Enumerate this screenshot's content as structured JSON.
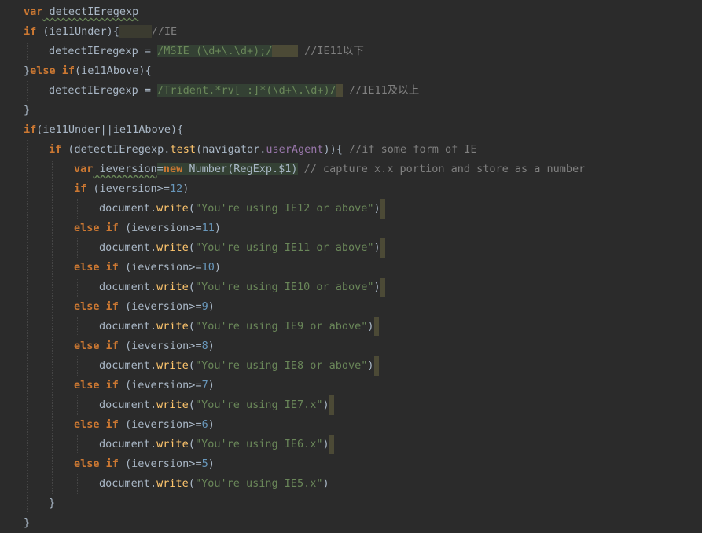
{
  "code": {
    "l1_kw": "var",
    "l1_id": " detectIEregexp",
    "l2_kw": "if",
    "l2_rest": " (ie11Under){",
    "l2_cm": "//IE",
    "l3_a": "detectIEregexp = ",
    "l3_s1": "/MSIE (\\d+\\.\\d+);/",
    "l3_cm": "//IE11以下",
    "l4_a": "}",
    "l4_kw1": "else",
    "l4_kw2": " if",
    "l4_rest": "(ie11Above){",
    "l5_a": "detectIEregexp = ",
    "l5_s1": "/Trident.*rv[ :]*(\\d+\\.\\d+)/",
    "l5_cm": "//IE11及以上",
    "l6": "}",
    "l7_kw": "if",
    "l7_rest": "(ie11Under||ie11Above){",
    "l8_kw": "if",
    "l8_a": " (detectIEregexp.",
    "l8_fn": "test",
    "l8_b": "(navigator.",
    "l8_prop": "userAgent",
    "l8_c": ")){",
    "l8_cm": " //if some form of IE",
    "l9_kw": "var",
    "l9_id": " ieversion",
    "l9_eq": "=",
    "l9_new": "new",
    "l9_rest": " Number(RegExp.$1)",
    "l9_cm": " // capture x.x portion and store as a number",
    "l10_kw": "if",
    "l10_a": " (ieversion>=",
    "l10_n": "12",
    "l10_b": ")",
    "l11_a": "document.",
    "l11_fn": "write",
    "l11_b": "(",
    "l11_s": "\"You're using IE12 or above\"",
    "l11_c": ")",
    "l12_kw": "else if",
    "l12_a": " (ieversion>=",
    "l12_n": "11",
    "l12_b": ")",
    "l13_a": "document.",
    "l13_fn": "write",
    "l13_b": "(",
    "l13_s": "\"You're using IE11 or above\"",
    "l13_c": ")",
    "l14_kw": "else if",
    "l14_a": " (ieversion>=",
    "l14_n": "10",
    "l14_b": ")",
    "l15_a": "document.",
    "l15_fn": "write",
    "l15_b": "(",
    "l15_s": "\"You're using IE10 or above\"",
    "l15_c": ")",
    "l16_kw": "else if",
    "l16_a": " (ieversion>=",
    "l16_n": "9",
    "l16_b": ")",
    "l17_a": "document.",
    "l17_fn": "write",
    "l17_b": "(",
    "l17_s": "\"You're using IE9 or above\"",
    "l17_c": ")",
    "l18_kw": "else if",
    "l18_a": " (ieversion>=",
    "l18_n": "8",
    "l18_b": ")",
    "l19_a": "document.",
    "l19_fn": "write",
    "l19_b": "(",
    "l19_s": "\"You're using IE8 or above\"",
    "l19_c": ")",
    "l20_kw": "else if",
    "l20_a": " (ieversion>=",
    "l20_n": "7",
    "l20_b": ")",
    "l21_a": "document.",
    "l21_fn": "write",
    "l21_b": "(",
    "l21_s": "\"You're using IE7.x\"",
    "l21_c": ")",
    "l22_kw": "else if",
    "l22_a": " (ieversion>=",
    "l22_n": "6",
    "l22_b": ")",
    "l23_a": "document.",
    "l23_fn": "write",
    "l23_b": "(",
    "l23_s": "\"You're using IE6.x\"",
    "l23_c": ")",
    "l24_kw": "else if",
    "l24_a": " (ieversion>=",
    "l24_n": "5",
    "l24_b": ")",
    "l25_a": "document.",
    "l25_fn": "write",
    "l25_b": "(",
    "l25_s": "\"You're using IE5.x\"",
    "l25_c": ")",
    "l26": "}",
    "l27": "}"
  }
}
